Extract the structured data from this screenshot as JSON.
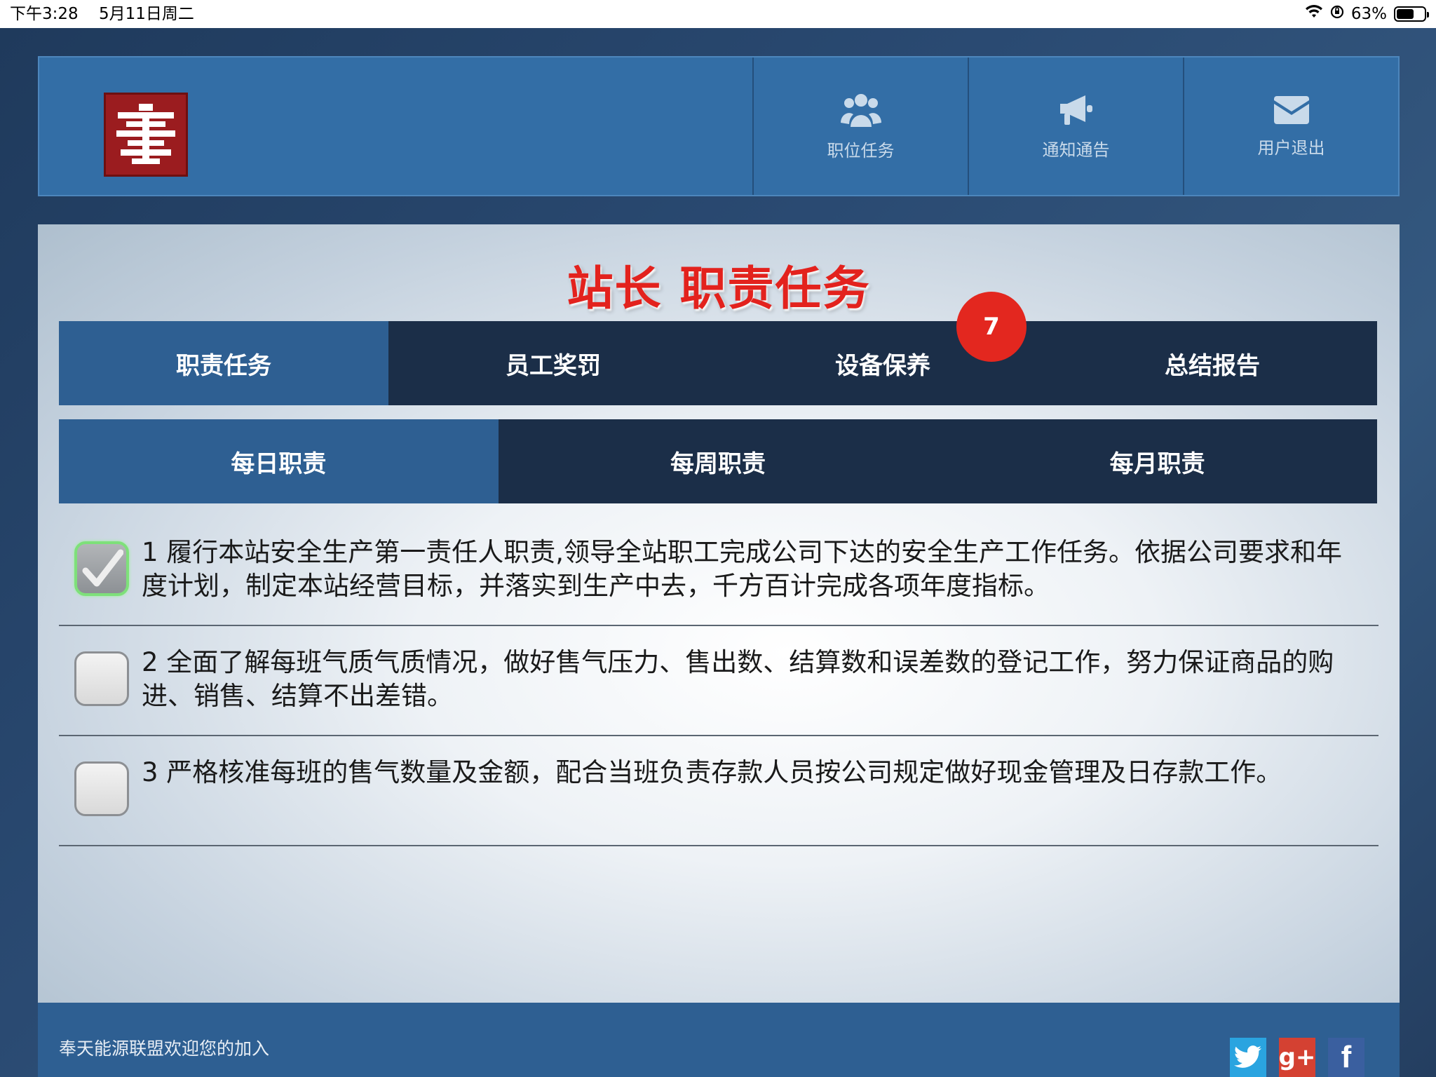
{
  "status_bar": {
    "time": "下午3:28",
    "date": "5月11日周二",
    "battery": "63%",
    "battery_level": 0.63
  },
  "header": {
    "logo_icon": "qin-logo",
    "nav": [
      {
        "label": "职位任务",
        "icon": "users-icon"
      },
      {
        "label": "通知通告",
        "icon": "megaphone-icon"
      },
      {
        "label": "用户退出",
        "icon": "envelope-icon"
      }
    ]
  },
  "page": {
    "title": "站长 职责任务",
    "tabs": [
      {
        "label": "职责任务",
        "active": true
      },
      {
        "label": "员工奖罚",
        "active": false
      },
      {
        "label": "设备保养",
        "active": false
      },
      {
        "label": "总结报告",
        "active": false
      }
    ],
    "badge": "7",
    "subtabs": [
      {
        "label": "每日职责",
        "active": true
      },
      {
        "label": "每周职责",
        "active": false
      },
      {
        "label": "每月职责",
        "active": false
      }
    ],
    "tasks": [
      {
        "text": "1 履行本站安全生产第一责任人职责,领导全站职工完成公司下达的安全生产工作任务。依据公司要求和年度计划，制定本站经营目标，并落实到生产中去，千方百计完成各项年度指标。",
        "checked": true
      },
      {
        "text": "2 全面了解每班气质气质情况，做好售气压力、售出数、结算数和误差数的登记工作，努力保证商品的购进、销售、结算不出差错。",
        "checked": false
      },
      {
        "text": "3 严格核准每班的售气数量及金额，配合当班负责存款人员按公司规定做好现金管理及日存款工作。",
        "checked": false
      }
    ]
  },
  "footer": {
    "text": "奉天能源联盟欢迎您的加入",
    "social": [
      {
        "name": "twitter",
        "glyph": "t"
      },
      {
        "name": "google-plus",
        "glyph": "g+"
      },
      {
        "name": "facebook",
        "glyph": "f"
      }
    ]
  },
  "colors": {
    "header_bg": "#336ea6",
    "tab_active": "#2e5f92",
    "tab_inactive": "#1b2e48",
    "title_red": "#e3221d",
    "badge_red": "#e3271f"
  }
}
